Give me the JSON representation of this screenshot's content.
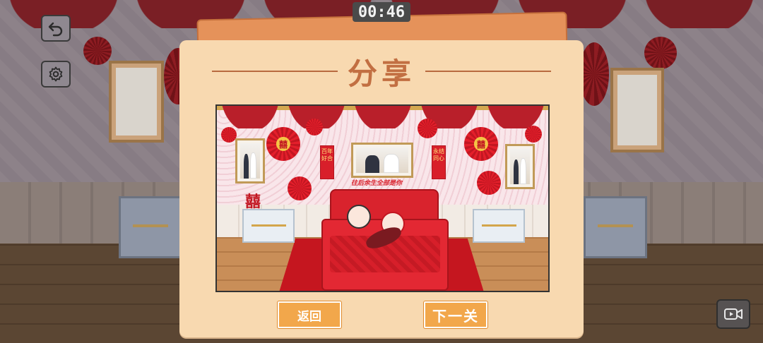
{
  "hud": {
    "timer": "00:46",
    "undo_icon": "undo-arrow-icon",
    "settings_icon": "gear-icon",
    "record_icon": "video-record-icon"
  },
  "dialog": {
    "title": "分享",
    "back_label": "返回",
    "next_label": "下一关"
  },
  "preview": {
    "couplet_left": "百年好合",
    "couplet_right": "永结同心",
    "banner": "往后余生全部是你",
    "double_happiness": "囍"
  },
  "colors": {
    "dialog_bg": "#f8d9b0",
    "title_color": "#c26f42",
    "button_orange": "#f2a74b",
    "wedding_red": "#d81f2a"
  }
}
